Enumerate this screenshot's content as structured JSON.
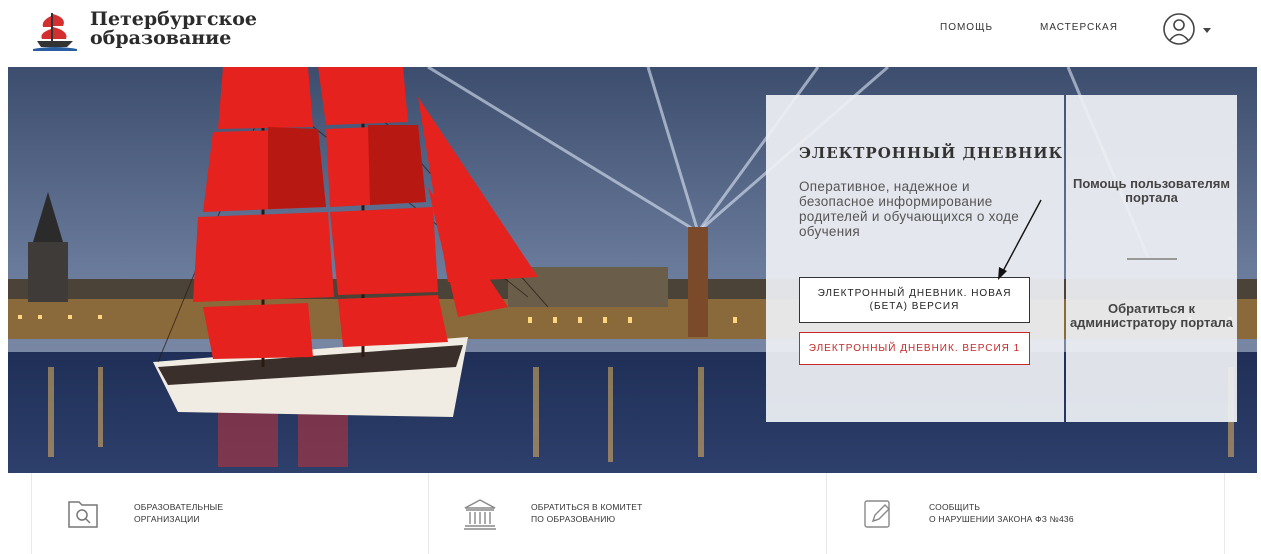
{
  "brand": {
    "line1": "Петербургское",
    "line2": "образование"
  },
  "nav": {
    "help": "ПОМОЩЬ",
    "workshop": "МАСТЕРСКАЯ"
  },
  "diary": {
    "title": "ЭЛЕКТРОННЫЙ ДНЕВНИК",
    "description": "Оперативное, надежное и безопасное информирование родителей и обучающихся о ходе обучения",
    "beta_button": "ЭЛЕКТРОННЫЙ ДНЕВНИК. НОВАЯ (БЕТА) ВЕРСИЯ",
    "v1_button": "ЭЛЕКТРОННЫЙ ДНЕВНИК. ВЕРСИЯ 1"
  },
  "help": {
    "users": "Помощь пользователям портала",
    "admin": "Обратиться к администратору портала"
  },
  "tiles": [
    {
      "line1": "ОБРАЗОВАТЕЛЬНЫЕ",
      "line2": "ОРГАНИЗАЦИИ",
      "icon": "search-folder-icon"
    },
    {
      "line1": "ОБРАТИТЬСЯ В КОМИТЕТ",
      "line2": "ПО ОБРАЗОВАНИЮ",
      "icon": "building-icon"
    },
    {
      "line1": "СООБЩИТЬ",
      "line2": "О НАРУШЕНИИ ЗАКОНА ФЗ №436",
      "icon": "edit-icon"
    }
  ],
  "colors": {
    "accent": "#c62828",
    "text": "#333333",
    "panel": "#eef0f4"
  }
}
